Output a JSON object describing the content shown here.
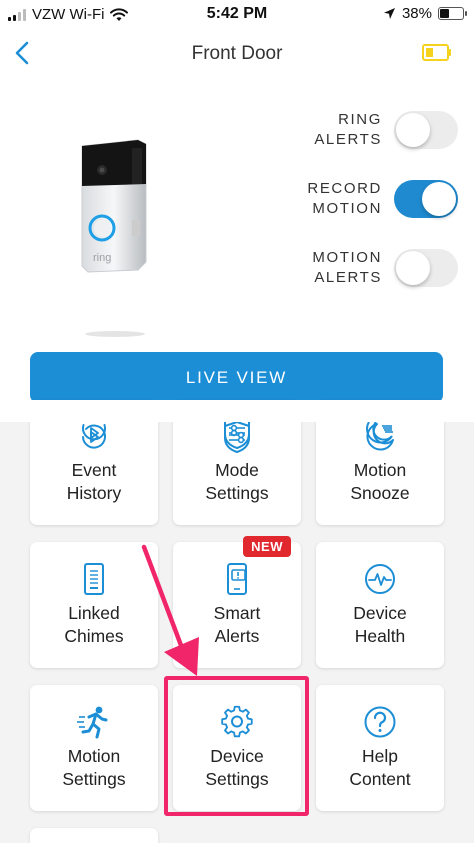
{
  "status_bar": {
    "carrier": "VZW Wi-Fi",
    "time": "5:42 PM",
    "battery_percent": "38%",
    "battery_level": 0.38
  },
  "header": {
    "title": "Front Door"
  },
  "toggles": [
    {
      "line1": "RING",
      "line2": "ALERTS",
      "on": false
    },
    {
      "line1": "RECORD",
      "line2": "MOTION",
      "on": true
    },
    {
      "line1": "MOTION",
      "line2": "ALERTS",
      "on": false
    }
  ],
  "doorbell": {
    "brand": "ring"
  },
  "live_view": {
    "label": "LIVE VIEW"
  },
  "tiles": [
    {
      "line1": "Event",
      "line2": "History",
      "icon": "event-history-icon"
    },
    {
      "line1": "Mode",
      "line2": "Settings",
      "icon": "mode-settings-icon"
    },
    {
      "line1": "Motion",
      "line2": "Snooze",
      "icon": "motion-snooze-icon"
    },
    {
      "line1": "Linked",
      "line2": "Chimes",
      "icon": "linked-chimes-icon"
    },
    {
      "line1": "Smart",
      "line2": "Alerts",
      "icon": "smart-alerts-icon",
      "badge": "NEW"
    },
    {
      "line1": "Device",
      "line2": "Health",
      "icon": "device-health-icon"
    },
    {
      "line1": "Motion",
      "line2": "Settings",
      "icon": "motion-settings-icon"
    },
    {
      "line1": "Device",
      "line2": "Settings",
      "icon": "device-settings-icon"
    },
    {
      "line1": "Help",
      "line2": "Content",
      "icon": "help-content-icon"
    }
  ],
  "colors": {
    "accent": "#1c8ed6",
    "highlight": "#f0256a",
    "badge": "#e0282e",
    "device_battery": "#f5d21d"
  }
}
